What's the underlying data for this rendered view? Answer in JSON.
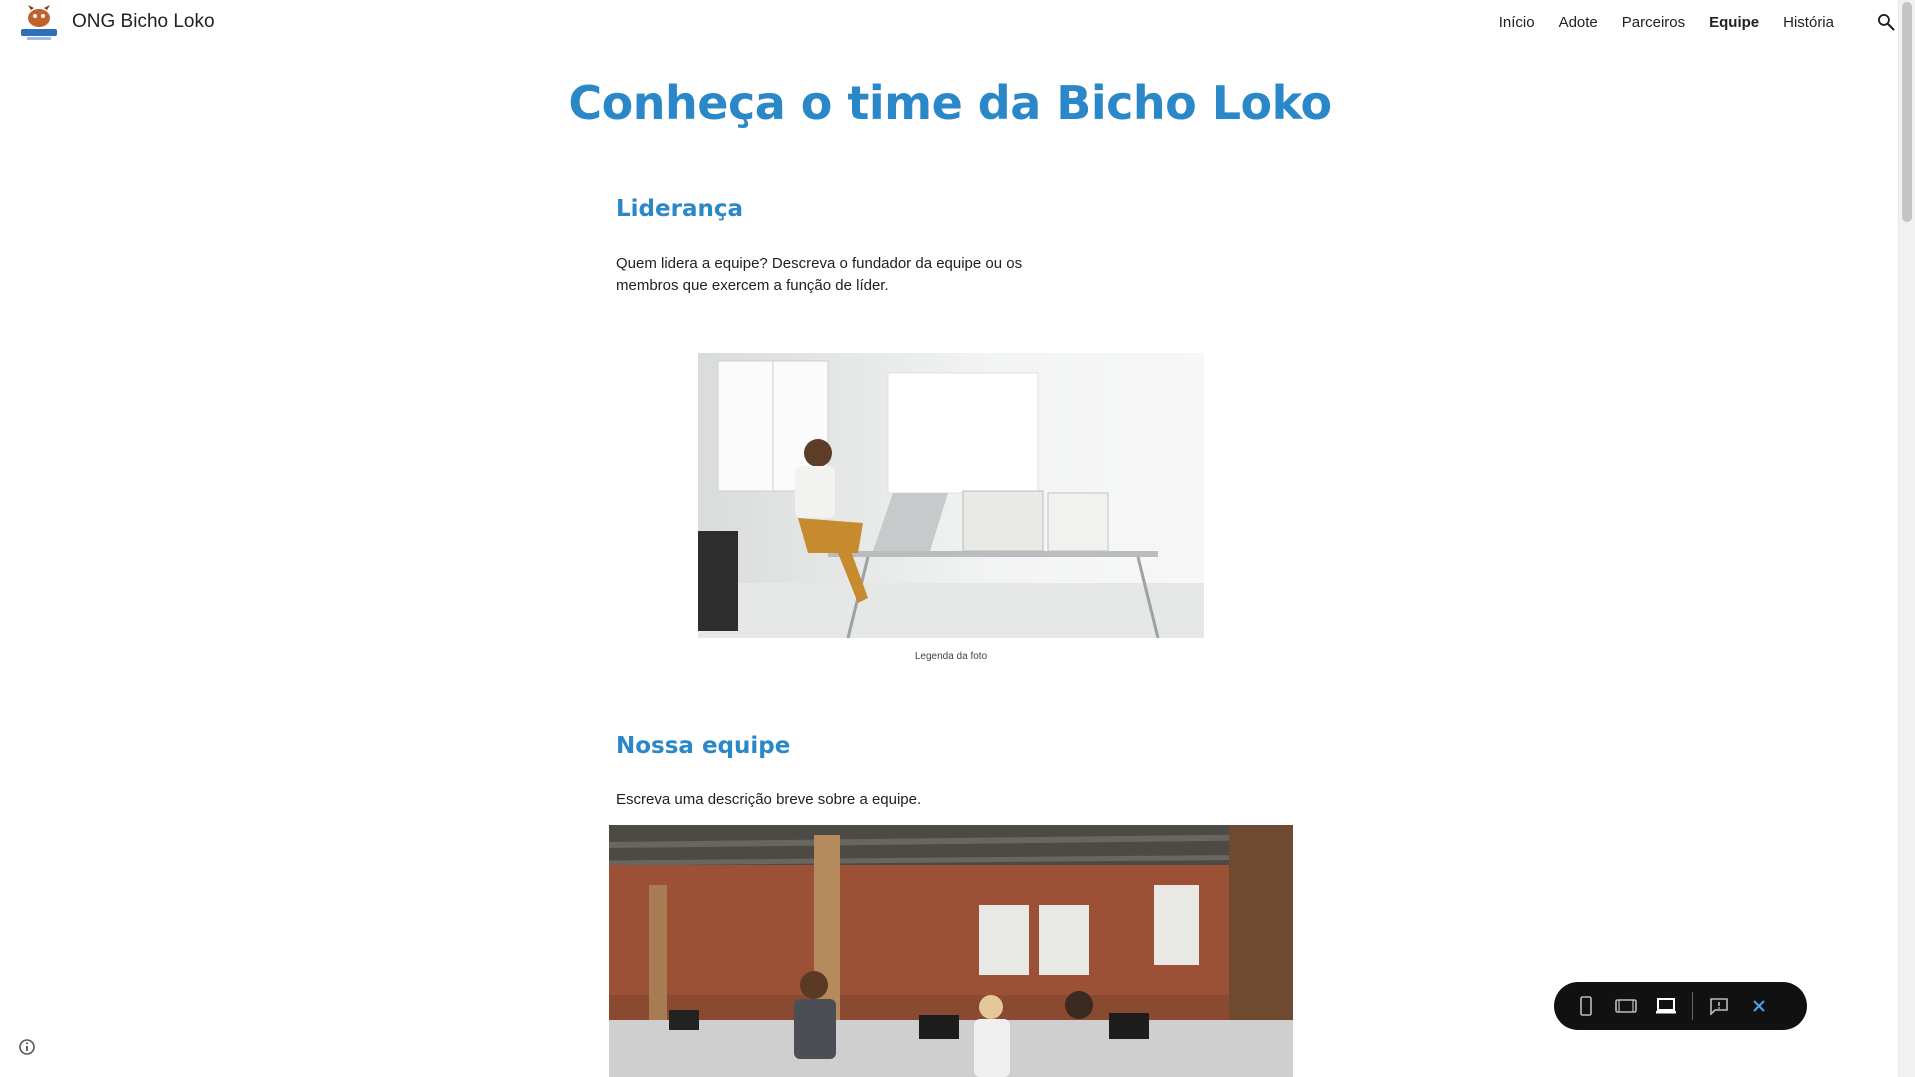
{
  "header": {
    "site_title": "ONG Bicho Loko",
    "nav": [
      {
        "label": "Início",
        "active": false
      },
      {
        "label": "Adote",
        "active": false
      },
      {
        "label": "Parceiros",
        "active": false
      },
      {
        "label": "Equipe",
        "active": true
      },
      {
        "label": "História",
        "active": false
      }
    ],
    "search_icon": "search-icon"
  },
  "main": {
    "title": "Conheça o time da Bicho Loko",
    "leadership": {
      "heading": "Liderança",
      "text": "Quem lidera a equipe? Descreva o fundador da equipe ou os membros que exercem a função de líder.",
      "caption": "Legenda da foto"
    },
    "team": {
      "heading": "Nossa equipe",
      "text": "Escreva uma descrição breve sobre a equipe."
    }
  },
  "viewer_toolbar": {
    "icons": [
      "phone-icon",
      "tablet-icon",
      "laptop-icon",
      "feedback-icon",
      "close-icon"
    ],
    "accent": "#4aa3f0"
  },
  "colors": {
    "accent": "#2a88c9",
    "text": "#212121"
  }
}
